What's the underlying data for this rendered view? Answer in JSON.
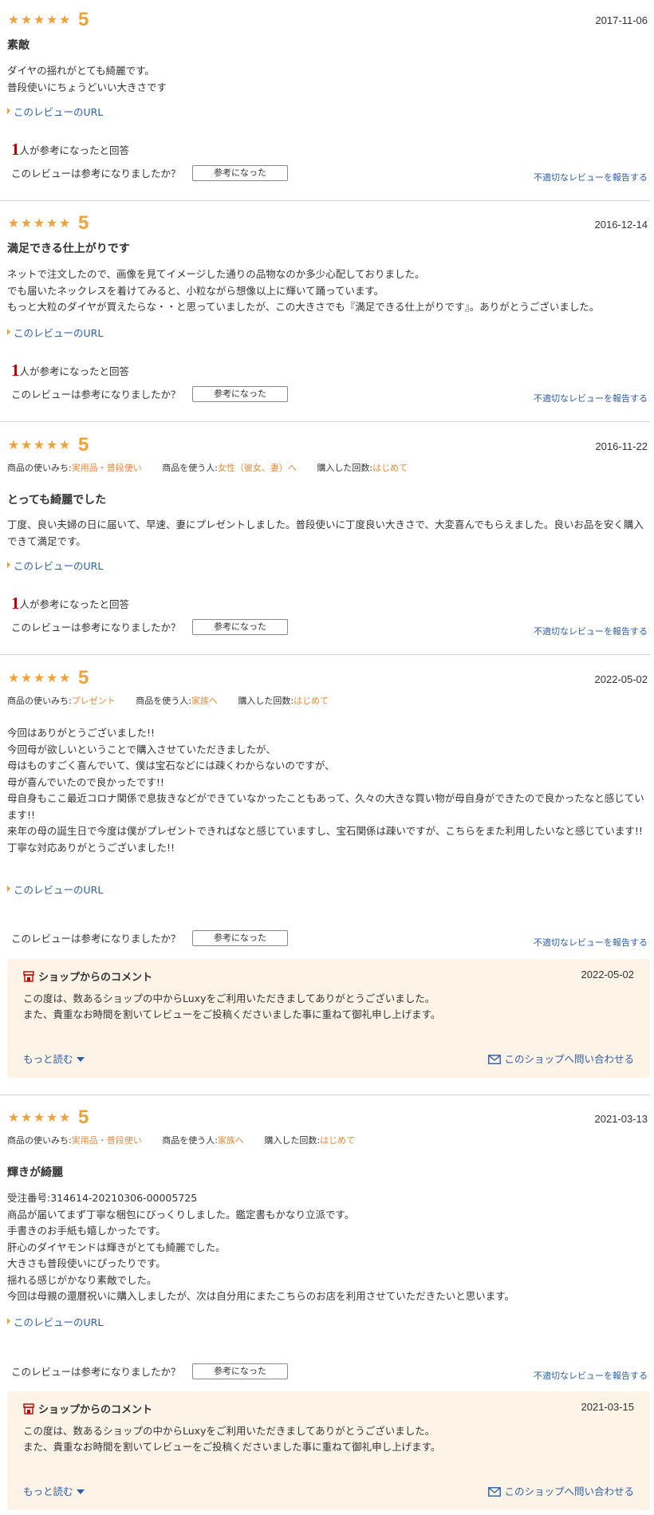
{
  "common": {
    "stars": "★★★★★",
    "url_label": "このレビューのURL",
    "ask_label": "このレビューは参考になりましたか？",
    "helpful_button": "参考になった",
    "report_label": "不適切なレビューを報告する",
    "helpful_suffix": "人が参考になったと回答",
    "meta_usage_label": "商品の使いみち:",
    "meta_user_label": "商品を使う人:",
    "meta_count_label": "購入した回数:",
    "shop_comment_title": "ショップからのコメント",
    "more_label": "もっと読む",
    "contact_label": "このショップへ問い合わせる"
  },
  "colors": {
    "star": "#f0a23a",
    "link": "#2c5ea8",
    "highlight": "#e8893a",
    "helpful_num": "#bf0000",
    "shop_bg": "#fdf3e7"
  },
  "reviews": [
    {
      "score": "5",
      "date": "2017-11-06",
      "title": "素敵",
      "body": [
        "ダイヤの揺れがとても綺麗です。",
        "普段使いにちょうどいい大きさです"
      ],
      "helpful_count": "1"
    },
    {
      "score": "5",
      "date": "2016-12-14",
      "title": "満足できる仕上がりです",
      "body": [
        "ネットで注文したので、画像を見てイメージした通りの品物なのか多少心配しておりました。",
        "でも届いたネックレスを着けてみると、小粒ながら想像以上に輝いて踊っています。",
        "もっと大粒のダイヤが買えたらな・・と思っていましたが、この大きさでも『満足できる仕上がりです』。ありがとうございました。"
      ],
      "helpful_count": "1"
    },
    {
      "score": "5",
      "date": "2016-11-22",
      "meta": {
        "usage": "実用品・普段使い",
        "user": "女性（彼女、妻）へ",
        "count": "はじめて"
      },
      "title": "とっても綺麗でした",
      "body": [
        "丁度、良い夫婦の日に届いて、早速、妻にプレゼントしました。普段使いに丁度良い大きさで、大変喜んでもらえました。良いお品を安く購入できて満足です。"
      ],
      "helpful_count": "1"
    },
    {
      "score": "5",
      "date": "2022-05-02",
      "meta": {
        "usage": "プレゼント",
        "user": "家族へ",
        "count": "はじめて"
      },
      "body": [
        "今回はありがとうございました!!",
        "今回母が欲しいということで購入させていただきましたが、",
        "母はものすごく喜んでいて、僕は宝石などには疎くわからないのですが、",
        "母が喜んでいたので良かったです!!",
        "母自身もここ最近コロナ関係で息抜きなどができていなかったこともあって、久々の大きな買い物が母自身ができたので良かったなと感じています!!",
        "来年の母の誕生日で今度は僕がプレゼントできればなと感じていますし、宝石関係は疎いですが、こちらをまた利用したいなと感じています!!",
        "丁寧な対応ありがとうございました!!"
      ],
      "shop": {
        "date": "2022-05-02",
        "text": [
          "この度は、数あるショップの中からLuxyをご利用いただきましてありがとうございました。",
          "また、貴重なお時間を割いてレビューをご投稿くださいました事に重ねて御礼申し上げます。"
        ]
      }
    },
    {
      "score": "5",
      "date": "2021-03-13",
      "meta": {
        "usage": "実用品・普段使い",
        "user": "家族へ",
        "count": "はじめて"
      },
      "title": "輝きが綺麗",
      "body": [
        "受注番号:314614-20210306-00005725",
        "商品が届いてまず丁寧な梱包にびっくりしました。鑑定書もかなり立派です。",
        "手書きのお手紙も嬉しかったです。",
        "肝心のダイヤモンドは輝きがとても綺麗でした。",
        "大きさも普段使いにぴったりです。",
        "揺れる感じがかなり素敵でした。",
        "今回は母親の還暦祝いに購入しましたが、次は自分用にまたこちらのお店を利用させていただきたいと思います。"
      ],
      "shop": {
        "date": "2021-03-15",
        "text": [
          "この度は、数あるショップの中からLuxyをご利用いただきましてありがとうございました。",
          "また、貴重なお時間を割いてレビューをご投稿くださいました事に重ねて御礼申し上げます。"
        ]
      }
    }
  ]
}
